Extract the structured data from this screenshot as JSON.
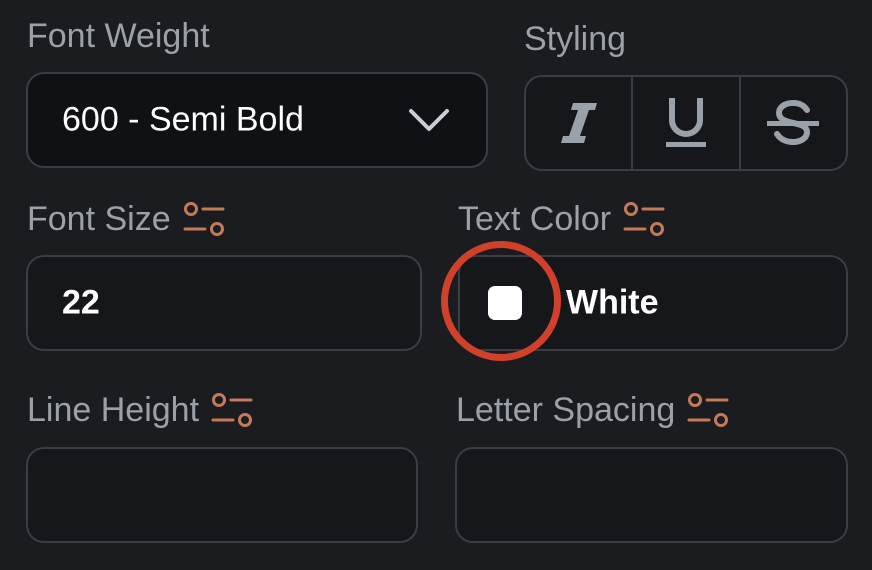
{
  "font_weight": {
    "label": "Font Weight",
    "selected": "600 - Semi Bold"
  },
  "styling": {
    "label": "Styling",
    "buttons": [
      {
        "icon": "italic-icon",
        "name": "Italic"
      },
      {
        "icon": "underline-icon",
        "name": "Underline"
      },
      {
        "icon": "strikethrough-icon",
        "name": "Strikethrough"
      }
    ]
  },
  "font_size": {
    "label": "Font Size",
    "value": "22",
    "variable_icon": "variable-settings-icon"
  },
  "text_color": {
    "label": "Text Color",
    "value": "White",
    "swatch_color": "#ffffff",
    "variable_icon": "variable-settings-icon"
  },
  "line_height": {
    "label": "Line Height",
    "value": "",
    "variable_icon": "variable-settings-icon"
  },
  "letter_spacing": {
    "label": "Letter Spacing",
    "value": "",
    "variable_icon": "variable-settings-icon"
  },
  "colors": {
    "background": "#1b1c1f",
    "border": "#3a3d43",
    "label_text": "#9ba1a9",
    "value_text": "#ffffff",
    "variable_icon": "#c47a5a",
    "highlight": "#d0402a"
  }
}
